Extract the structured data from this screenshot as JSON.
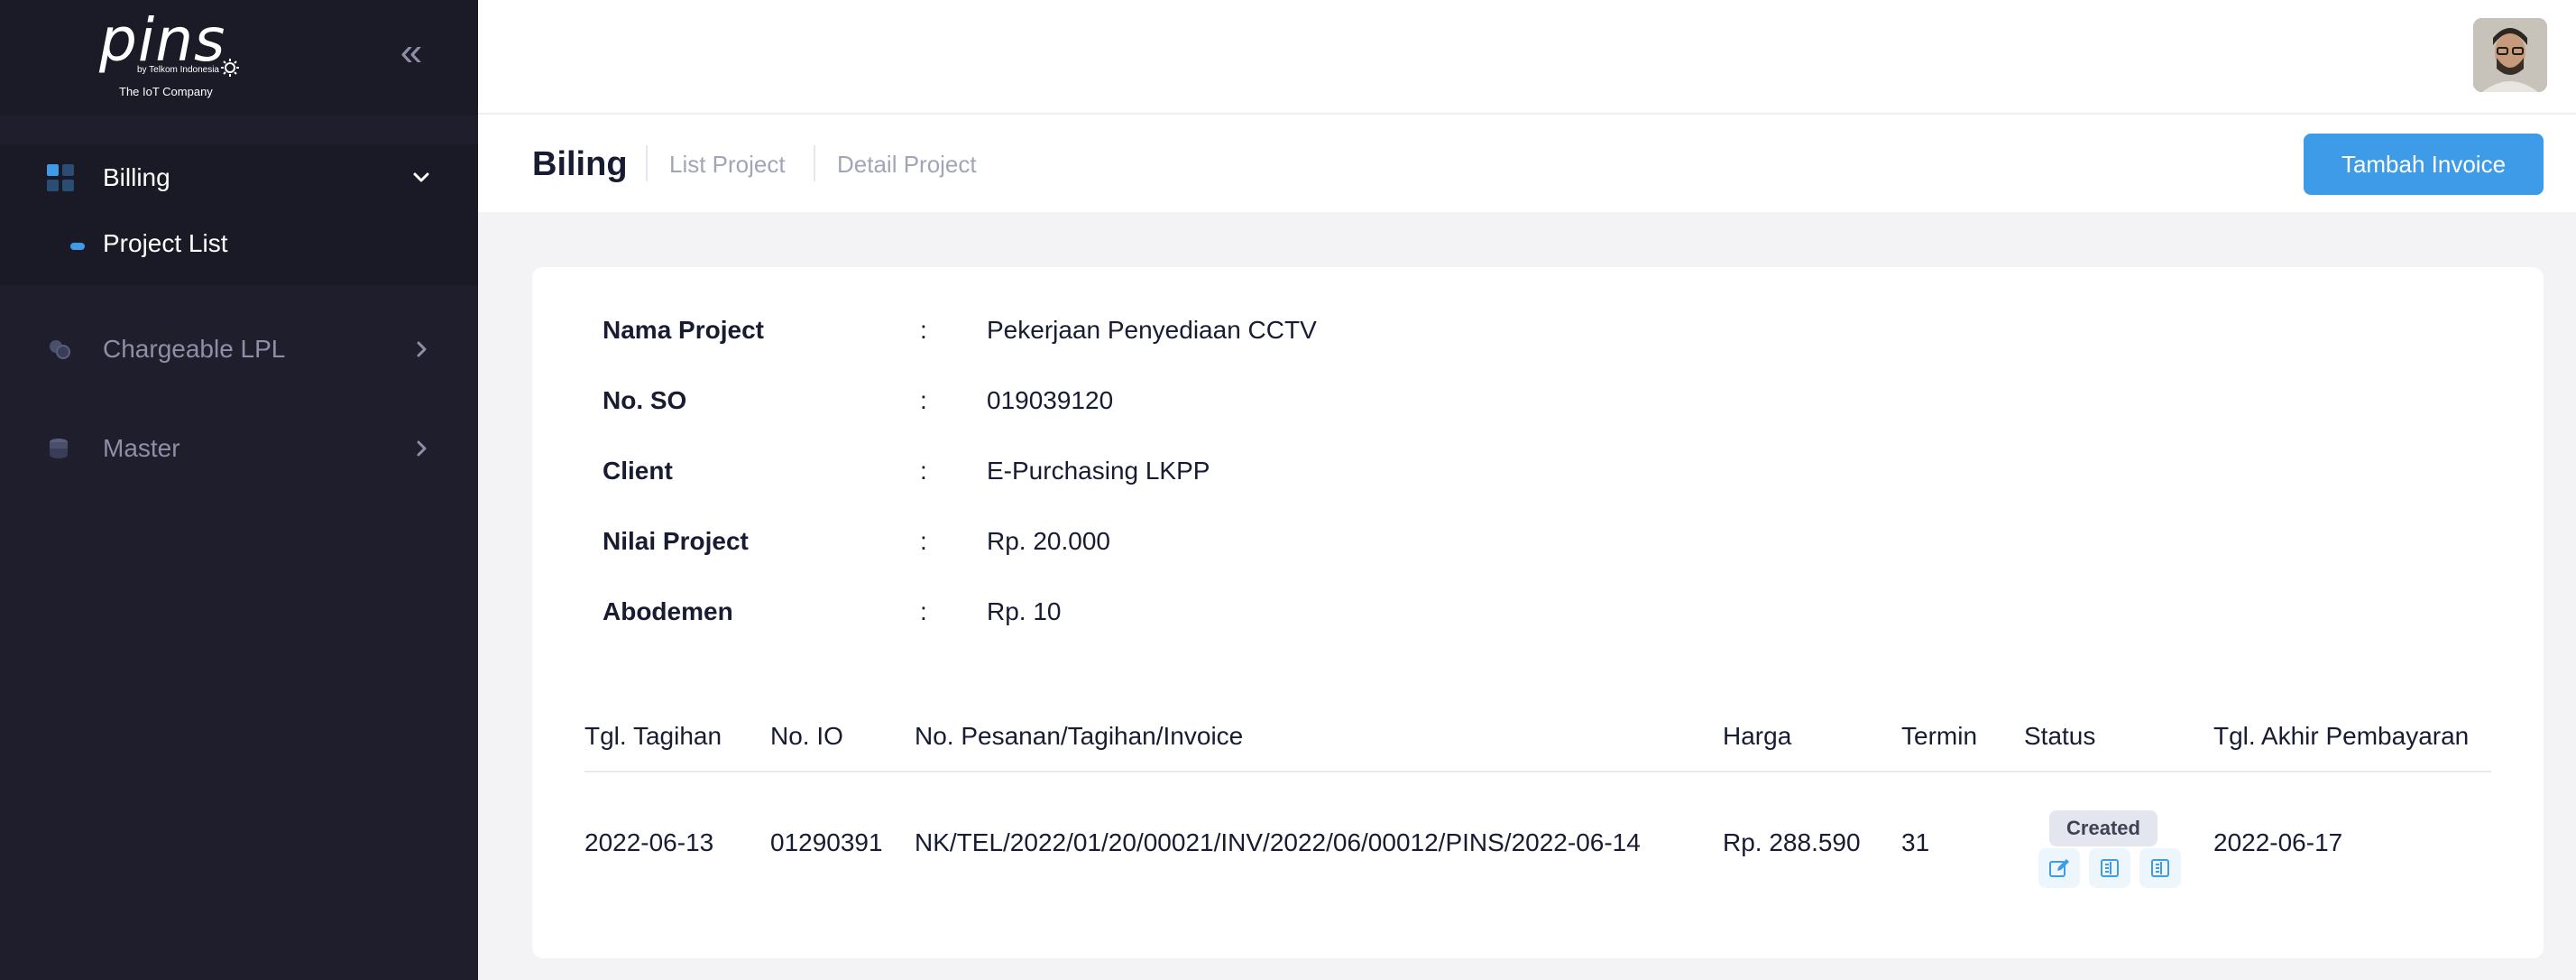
{
  "sidebar": {
    "logo": {
      "wordmark": "pins",
      "byline": "by Telkom Indonesia",
      "tagline": "The IoT Company"
    },
    "menu": [
      {
        "label": "Billing",
        "icon": "grid-icon",
        "expanded": true
      },
      {
        "label": "Chargeable LPL",
        "icon": "coins-icon",
        "expanded": false
      },
      {
        "label": "Master",
        "icon": "stack-icon",
        "expanded": false
      }
    ],
    "submenu": [
      {
        "label": "Project List",
        "active": true
      }
    ]
  },
  "header": {
    "title": "Biling",
    "breadcrumbs": [
      "List Project",
      "Detail Project"
    ],
    "add_button": "Tambah Invoice"
  },
  "project": {
    "fields": [
      {
        "label": "Nama Project",
        "colon": ":",
        "value": "Pekerjaan Penyediaan CCTV"
      },
      {
        "label": "No. SO",
        "colon": ":",
        "value": "019039120"
      },
      {
        "label": "Client",
        "colon": ":",
        "value": "E-Purchasing LKPP"
      },
      {
        "label": "Nilai Project",
        "colon": ":",
        "value": "Rp. 20.000"
      },
      {
        "label": "Abodemen",
        "colon": ":",
        "value": "Rp. 10"
      }
    ]
  },
  "table": {
    "columns": [
      "Tgl. Tagihan",
      "No. IO",
      "No. Pesanan/Tagihan/Invoice",
      "Harga",
      "Termin",
      "Status",
      "Tgl. Akhir Pembayaran"
    ],
    "rows": [
      {
        "tgl_tagihan": "2022-06-13",
        "no_io": "01290391",
        "invoice": "NK/TEL/2022/01/20/00021/INV/2022/06/00012/PINS/2022-06-14",
        "harga": "Rp. 288.590",
        "termin": "31",
        "status": "Created",
        "tgl_akhir": "2022-06-17"
      }
    ]
  },
  "colors": {
    "accent": "#3e9be8",
    "sidebar_bg": "#1e1e2d",
    "page_bg": "#f3f3f6"
  }
}
